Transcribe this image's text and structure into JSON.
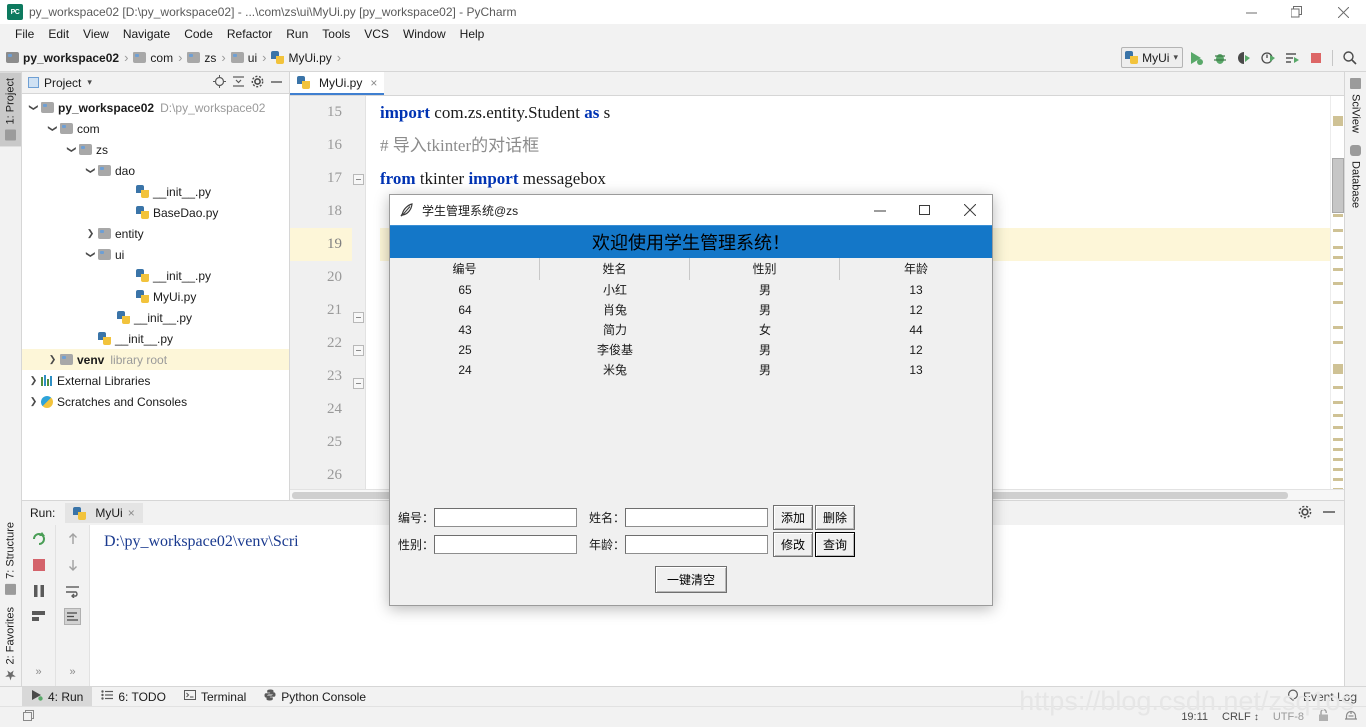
{
  "window": {
    "title": "py_workspace02 [D:\\py_workspace02] - ...\\com\\zs\\ui\\MyUi.py [py_workspace02] - PyCharm",
    "app_icon": "pycharm-icon",
    "minimize": "minimize-icon",
    "maximize": "restore-icon",
    "close": "close-icon"
  },
  "menubar": {
    "items": [
      "File",
      "Edit",
      "View",
      "Navigate",
      "Code",
      "Refactor",
      "Run",
      "Tools",
      "VCS",
      "Window",
      "Help"
    ]
  },
  "breadcrumb": {
    "items": [
      "py_workspace02",
      "com",
      "zs",
      "ui",
      "MyUi.py"
    ],
    "separator": "›"
  },
  "toolbar": {
    "run_config": "MyUi",
    "chevron": "chevron-down-icon",
    "actions": [
      "run-icon",
      "debug-icon",
      "coverage-icon",
      "profile-icon",
      "run-with-console-icon",
      "stop-icon",
      "search-icon"
    ]
  },
  "left_rail": {
    "tabs": [
      "1: Project",
      "7: Structure",
      "2: Favorites"
    ]
  },
  "right_rail": {
    "tabs": [
      "SciView",
      "Database"
    ]
  },
  "project_panel": {
    "title": "Project",
    "chevron": "chevron-down-icon",
    "actions": [
      "locate-icon",
      "collapse-all-icon",
      "settings-icon",
      "hide-icon"
    ],
    "tree": [
      {
        "label": "py_workspace02",
        "sub": "D:\\py_workspace02",
        "indent": 0,
        "arrow": "v",
        "icon": "folder",
        "bold": true,
        "highlight": false
      },
      {
        "label": "com",
        "sub": "",
        "indent": 1,
        "arrow": "v",
        "icon": "folder",
        "bold": false,
        "highlight": false
      },
      {
        "label": "zs",
        "sub": "",
        "indent": 2,
        "arrow": "v",
        "icon": "folder",
        "bold": false,
        "highlight": false
      },
      {
        "label": "dao",
        "sub": "",
        "indent": 3,
        "arrow": "v",
        "icon": "folder",
        "bold": false,
        "highlight": false
      },
      {
        "label": "__init__.py",
        "sub": "",
        "indent": 5,
        "arrow": "",
        "icon": "python",
        "bold": false,
        "highlight": false
      },
      {
        "label": "BaseDao.py",
        "sub": "",
        "indent": 5,
        "arrow": "",
        "icon": "python",
        "bold": false,
        "highlight": false
      },
      {
        "label": "entity",
        "sub": "",
        "indent": 3,
        "arrow": ">",
        "icon": "folder",
        "bold": false,
        "highlight": false
      },
      {
        "label": "ui",
        "sub": "",
        "indent": 3,
        "arrow": "v",
        "icon": "folder",
        "bold": false,
        "highlight": false
      },
      {
        "label": "__init__.py",
        "sub": "",
        "indent": 5,
        "arrow": "",
        "icon": "python",
        "bold": false,
        "highlight": false
      },
      {
        "label": "MyUi.py",
        "sub": "",
        "indent": 5,
        "arrow": "",
        "icon": "python",
        "bold": false,
        "highlight": false
      },
      {
        "label": "__init__.py",
        "sub": "",
        "indent": 4,
        "arrow": "",
        "icon": "python",
        "bold": false,
        "highlight": false
      },
      {
        "label": "__init__.py",
        "sub": "",
        "indent": 3,
        "arrow": "",
        "icon": "python",
        "bold": false,
        "highlight": false
      },
      {
        "label": "venv",
        "sub": "library root",
        "indent": 1,
        "arrow": ">",
        "icon": "folder",
        "bold": true,
        "highlight": true
      },
      {
        "label": "External Libraries",
        "sub": "",
        "indent": 0,
        "arrow": ">",
        "icon": "libraries",
        "bold": false,
        "highlight": false
      },
      {
        "label": "Scratches and Consoles",
        "sub": "",
        "indent": 0,
        "arrow": ">",
        "icon": "scratch",
        "bold": false,
        "highlight": false
      }
    ]
  },
  "editor": {
    "tab": {
      "label": "MyUi.py",
      "icon": "python-file-icon",
      "close": "×"
    },
    "first_line_number": 15,
    "current_line": 19,
    "lines": [
      {
        "n": 15,
        "tokens": [
          {
            "t": "import ",
            "c": "kw"
          },
          {
            "t": "com.zs.entity.Student ",
            "c": "plain"
          },
          {
            "t": "as ",
            "c": "kw"
          },
          {
            "t": "s",
            "c": "plain"
          }
        ]
      },
      {
        "n": 16,
        "tokens": [
          {
            "t": "# 导入tkinter的对话框",
            "c": "cmt"
          }
        ]
      },
      {
        "n": 17,
        "tokens": [
          {
            "t": "from ",
            "c": "kw"
          },
          {
            "t": "tkinter ",
            "c": "plain"
          },
          {
            "t": "import ",
            "c": "kw"
          },
          {
            "t": "messagebox",
            "c": "plain"
          }
        ]
      },
      {
        "n": 18,
        "tokens": []
      },
      {
        "n": 19,
        "tokens": []
      },
      {
        "n": 20,
        "tokens": []
      },
      {
        "n": 21,
        "tokens": []
      },
      {
        "n": 22,
        "tokens": []
      },
      {
        "n": 23,
        "tokens": []
      },
      {
        "n": 24,
        "tokens": []
      },
      {
        "n": 25,
        "tokens": []
      },
      {
        "n": 26,
        "tokens": []
      }
    ]
  },
  "run_window": {
    "label": "Run:",
    "tab": "MyUi",
    "tab_icon": "python-run-icon",
    "close": "×",
    "settings_icon": "gear-icon",
    "hide_icon": "hide-icon",
    "actions": [
      "rerun-icon",
      "stop-icon",
      "pause-icon",
      "dump-threads-icon",
      "expand-icon"
    ],
    "actions2": [
      "up-icon",
      "down-icon",
      "soft-wrap-icon",
      "scroll-to-end-icon"
    ],
    "more": "»",
    "console_text": "D:\\py_workspace02\\venv\\Scri"
  },
  "bottom_tabs": {
    "items": [
      {
        "label": "4: Run",
        "icon": "run-icon",
        "selected": true
      },
      {
        "label": "6: TODO",
        "icon": "todo-icon",
        "selected": false
      },
      {
        "label": "Terminal",
        "icon": "terminal-icon",
        "selected": false
      },
      {
        "label": "Python Console",
        "icon": "python-console-icon",
        "selected": false
      }
    ]
  },
  "status_bar": {
    "event_log": "Event Log",
    "event_log_icon": "balloon-icon",
    "position": "19:11",
    "line_separator": "CRLF",
    "line_separator_chevron": "↕",
    "encoding": "UTF-8",
    "lock_icon": "lock-icon",
    "inspection_icon": "hector-icon"
  },
  "watermark": "https://blog.csdn.net/zsq1os",
  "dialog": {
    "title": "学生管理系统@zs",
    "icon": "tkinter-feather-icon",
    "minimize": "minimize-icon",
    "maximize": "maximize-icon",
    "close": "close-icon",
    "banner": "欢迎使用学生管理系统！",
    "banner_bg": "#1477c8",
    "table": {
      "headers": [
        "编号",
        "姓名",
        "性别",
        "年龄"
      ],
      "rows": [
        [
          "65",
          "小红",
          "男",
          "13"
        ],
        [
          "64",
          "肖兔",
          "男",
          "12"
        ],
        [
          "43",
          "简力",
          "女",
          "44"
        ],
        [
          "25",
          "李俊基",
          "男",
          "12"
        ],
        [
          "24",
          "米兔",
          "男",
          "13"
        ]
      ]
    },
    "form": {
      "fields": [
        {
          "label": "编号：",
          "value": ""
        },
        {
          "label": "姓名：",
          "value": ""
        },
        {
          "label": "性别：",
          "value": ""
        },
        {
          "label": "年龄：",
          "value": ""
        }
      ],
      "buttons": {
        "add": "添加",
        "delete": "删除",
        "modify": "修改",
        "query": "查询",
        "clear": "一键清空"
      }
    }
  }
}
